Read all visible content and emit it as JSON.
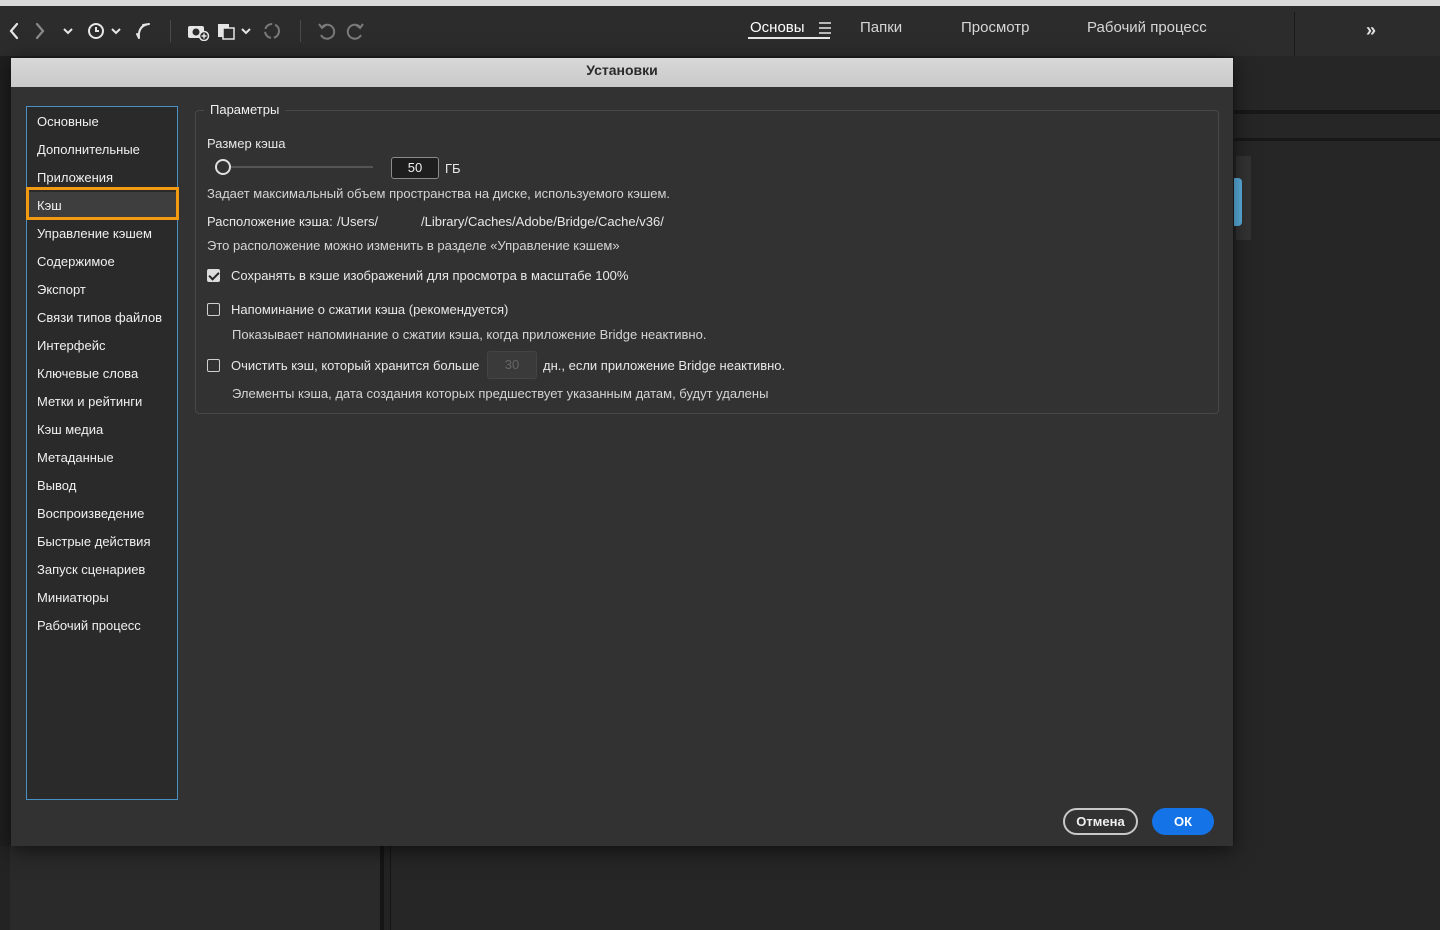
{
  "toolbar": {
    "workspace_tabs": [
      {
        "label": "Основы",
        "active": true
      },
      {
        "label": "Папки",
        "active": false
      },
      {
        "label": "Просмотр",
        "active": false
      },
      {
        "label": "Рабочий процесс",
        "active": false
      }
    ],
    "more_label": "»"
  },
  "dialog": {
    "title": "Установки",
    "categories": [
      "Основные",
      "Дополнительные",
      "Приложения",
      "Кэш",
      "Управление кэшем",
      "Содержимое",
      "Экспорт",
      "Связи типов файлов",
      "Интерфейс",
      "Ключевые слова",
      "Метки и рейтинги",
      "Кэш медиа",
      "Метаданные",
      "Вывод",
      "Воспроизведение",
      "Быстрые действия",
      "Запуск сценариев",
      "Миниатюры",
      "Рабочий процесс"
    ],
    "selected_category": "Кэш",
    "params": {
      "legend": "Параметры",
      "cache_size_label": "Размер кэша",
      "cache_size_value": "50",
      "cache_size_unit": "ГБ",
      "cache_size_desc": "Задает максимальный объем пространства на диске, используемого кэшем.",
      "location_label": "Расположение кэша:",
      "location_path_a": "/Users/",
      "location_path_b": "/Library/Caches/Adobe/Bridge/Cache/v36/",
      "location_hint": "Это расположение можно изменить в разделе «Управление кэшем»",
      "keep_100_label": "Сохранять в кэше изображений для просмотра в масштабе 100%",
      "keep_100_checked": true,
      "reminder_label": "Напоминание о сжатии кэша (рекомендуется)",
      "reminder_checked": false,
      "reminder_desc": "Показывает напоминание о сжатии кэша, когда приложение Bridge неактивно.",
      "purge_label_a": "Очистить кэш, который хранится больше",
      "purge_days_placeholder": "30",
      "purge_label_b": "дн., если приложение Bridge неактивно.",
      "purge_checked": false,
      "purge_desc": "Элементы кэша, дата создания которых предшествует указанным датам, будут удалены"
    },
    "buttons": {
      "cancel": "Отмена",
      "ok": "ОК"
    }
  },
  "colors": {
    "highlight": "#f39a13",
    "ok_button": "#1473e6",
    "list_border": "#4a90c4"
  }
}
